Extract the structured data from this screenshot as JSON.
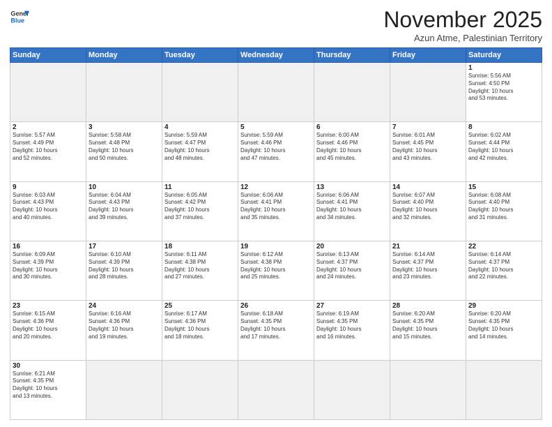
{
  "header": {
    "logo_line1": "General",
    "logo_line2": "Blue",
    "title": "November 2025",
    "subtitle": "Azun Atme, Palestinian Territory"
  },
  "weekdays": [
    "Sunday",
    "Monday",
    "Tuesday",
    "Wednesday",
    "Thursday",
    "Friday",
    "Saturday"
  ],
  "days": [
    {
      "num": "",
      "info": ""
    },
    {
      "num": "",
      "info": ""
    },
    {
      "num": "",
      "info": ""
    },
    {
      "num": "",
      "info": ""
    },
    {
      "num": "",
      "info": ""
    },
    {
      "num": "",
      "info": ""
    },
    {
      "num": "1",
      "info": "Sunrise: 5:56 AM\nSunset: 4:50 PM\nDaylight: 10 hours\nand 53 minutes."
    },
    {
      "num": "2",
      "info": "Sunrise: 5:57 AM\nSunset: 4:49 PM\nDaylight: 10 hours\nand 52 minutes."
    },
    {
      "num": "3",
      "info": "Sunrise: 5:58 AM\nSunset: 4:48 PM\nDaylight: 10 hours\nand 50 minutes."
    },
    {
      "num": "4",
      "info": "Sunrise: 5:59 AM\nSunset: 4:47 PM\nDaylight: 10 hours\nand 48 minutes."
    },
    {
      "num": "5",
      "info": "Sunrise: 5:59 AM\nSunset: 4:46 PM\nDaylight: 10 hours\nand 47 minutes."
    },
    {
      "num": "6",
      "info": "Sunrise: 6:00 AM\nSunset: 4:46 PM\nDaylight: 10 hours\nand 45 minutes."
    },
    {
      "num": "7",
      "info": "Sunrise: 6:01 AM\nSunset: 4:45 PM\nDaylight: 10 hours\nand 43 minutes."
    },
    {
      "num": "8",
      "info": "Sunrise: 6:02 AM\nSunset: 4:44 PM\nDaylight: 10 hours\nand 42 minutes."
    },
    {
      "num": "9",
      "info": "Sunrise: 6:03 AM\nSunset: 4:43 PM\nDaylight: 10 hours\nand 40 minutes."
    },
    {
      "num": "10",
      "info": "Sunrise: 6:04 AM\nSunset: 4:43 PM\nDaylight: 10 hours\nand 39 minutes."
    },
    {
      "num": "11",
      "info": "Sunrise: 6:05 AM\nSunset: 4:42 PM\nDaylight: 10 hours\nand 37 minutes."
    },
    {
      "num": "12",
      "info": "Sunrise: 6:06 AM\nSunset: 4:41 PM\nDaylight: 10 hours\nand 35 minutes."
    },
    {
      "num": "13",
      "info": "Sunrise: 6:06 AM\nSunset: 4:41 PM\nDaylight: 10 hours\nand 34 minutes."
    },
    {
      "num": "14",
      "info": "Sunrise: 6:07 AM\nSunset: 4:40 PM\nDaylight: 10 hours\nand 32 minutes."
    },
    {
      "num": "15",
      "info": "Sunrise: 6:08 AM\nSunset: 4:40 PM\nDaylight: 10 hours\nand 31 minutes."
    },
    {
      "num": "16",
      "info": "Sunrise: 6:09 AM\nSunset: 4:39 PM\nDaylight: 10 hours\nand 30 minutes."
    },
    {
      "num": "17",
      "info": "Sunrise: 6:10 AM\nSunset: 4:39 PM\nDaylight: 10 hours\nand 28 minutes."
    },
    {
      "num": "18",
      "info": "Sunrise: 6:11 AM\nSunset: 4:38 PM\nDaylight: 10 hours\nand 27 minutes."
    },
    {
      "num": "19",
      "info": "Sunrise: 6:12 AM\nSunset: 4:38 PM\nDaylight: 10 hours\nand 25 minutes."
    },
    {
      "num": "20",
      "info": "Sunrise: 6:13 AM\nSunset: 4:37 PM\nDaylight: 10 hours\nand 24 minutes."
    },
    {
      "num": "21",
      "info": "Sunrise: 6:14 AM\nSunset: 4:37 PM\nDaylight: 10 hours\nand 23 minutes."
    },
    {
      "num": "22",
      "info": "Sunrise: 6:14 AM\nSunset: 4:37 PM\nDaylight: 10 hours\nand 22 minutes."
    },
    {
      "num": "23",
      "info": "Sunrise: 6:15 AM\nSunset: 4:36 PM\nDaylight: 10 hours\nand 20 minutes."
    },
    {
      "num": "24",
      "info": "Sunrise: 6:16 AM\nSunset: 4:36 PM\nDaylight: 10 hours\nand 19 minutes."
    },
    {
      "num": "25",
      "info": "Sunrise: 6:17 AM\nSunset: 4:36 PM\nDaylight: 10 hours\nand 18 minutes."
    },
    {
      "num": "26",
      "info": "Sunrise: 6:18 AM\nSunset: 4:35 PM\nDaylight: 10 hours\nand 17 minutes."
    },
    {
      "num": "27",
      "info": "Sunrise: 6:19 AM\nSunset: 4:35 PM\nDaylight: 10 hours\nand 16 minutes."
    },
    {
      "num": "28",
      "info": "Sunrise: 6:20 AM\nSunset: 4:35 PM\nDaylight: 10 hours\nand 15 minutes."
    },
    {
      "num": "29",
      "info": "Sunrise: 6:20 AM\nSunset: 4:35 PM\nDaylight: 10 hours\nand 14 minutes."
    },
    {
      "num": "30",
      "info": "Sunrise: 6:21 AM\nSunset: 4:35 PM\nDaylight: 10 hours\nand 13 minutes."
    },
    {
      "num": "",
      "info": ""
    },
    {
      "num": "",
      "info": ""
    },
    {
      "num": "",
      "info": ""
    },
    {
      "num": "",
      "info": ""
    },
    {
      "num": "",
      "info": ""
    },
    {
      "num": "",
      "info": ""
    }
  ]
}
